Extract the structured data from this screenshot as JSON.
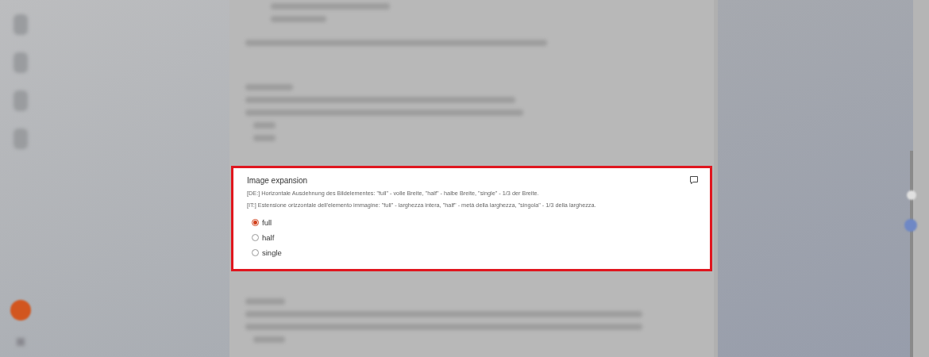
{
  "field": {
    "title": "Image expansion",
    "descriptions": [
      "[DE:] Horizontale Ausdehnung des Bildelementes: \"full\" - volle Breite, \"half\" - halbe Breite, \"single\" - 1/3 der Breite.",
      "[IT:] Estensione orizzontale dell'elemento immagine: \"full\" - larghezza intera, \"half\" - metà della larghezza, \"singola\" - 1/3 della larghezza."
    ],
    "options": [
      {
        "label": "full",
        "selected": true
      },
      {
        "label": "half",
        "selected": false
      },
      {
        "label": "single",
        "selected": false
      }
    ]
  }
}
